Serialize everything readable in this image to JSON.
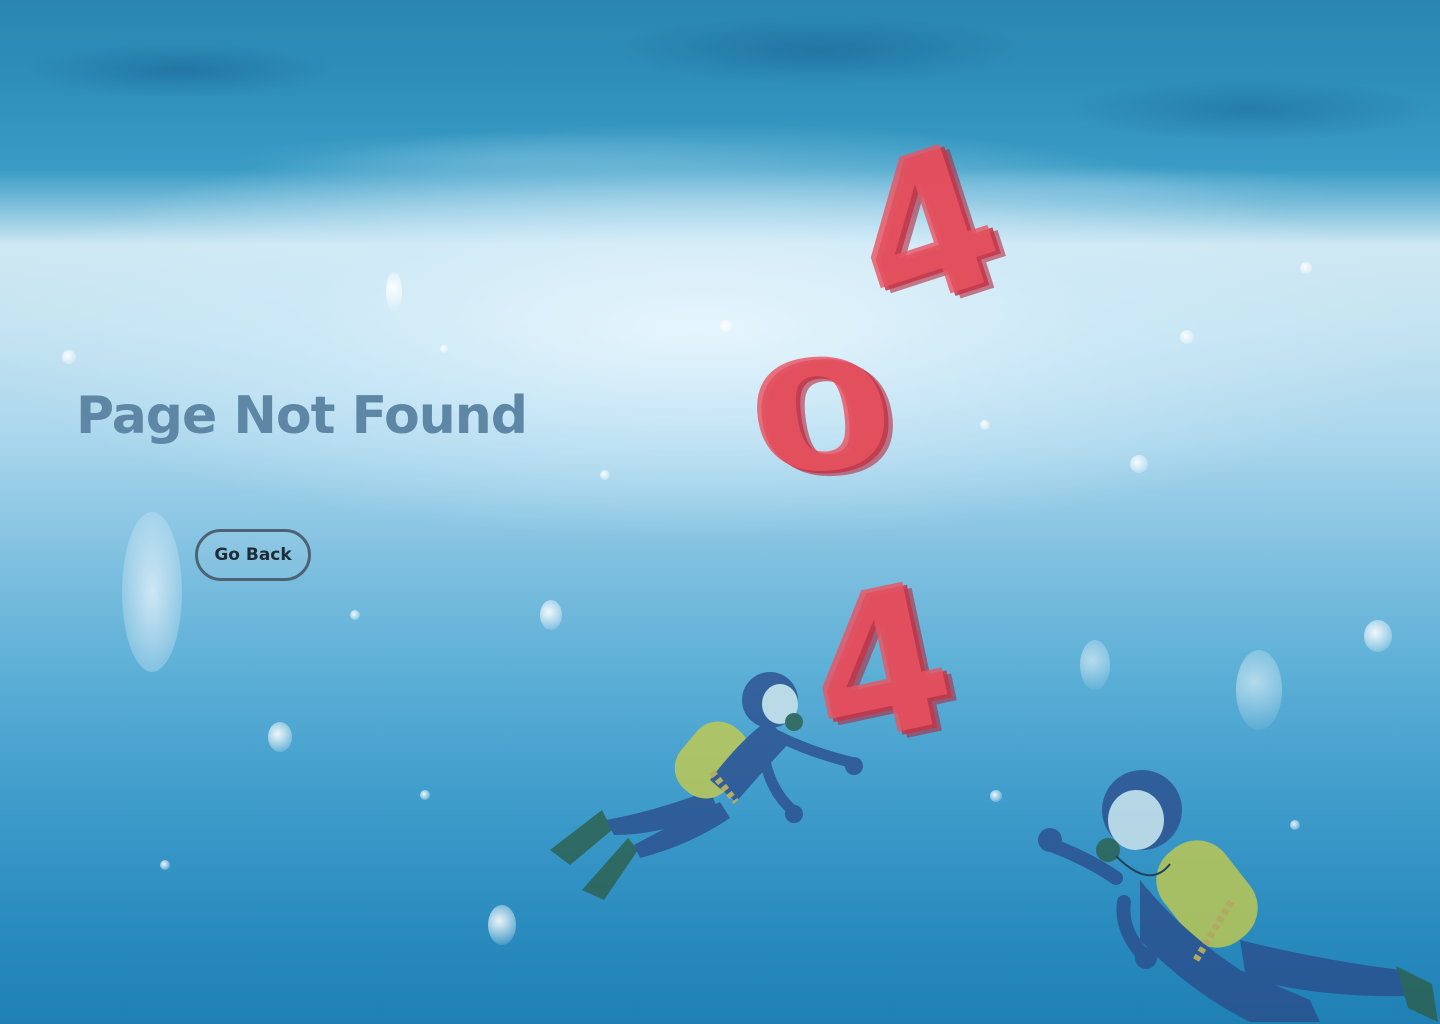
{
  "page": {
    "title": "Page Not Found",
    "go_back_label": "Go Back"
  },
  "illustration": {
    "digits": [
      "4",
      "0",
      "4"
    ],
    "digit_color": "#e95462",
    "scene": "underwater",
    "figures": [
      "diver",
      "diver"
    ]
  },
  "colors": {
    "title": "#5d87a4",
    "button_border": "#4d6373",
    "button_text": "#1d2e3a"
  }
}
